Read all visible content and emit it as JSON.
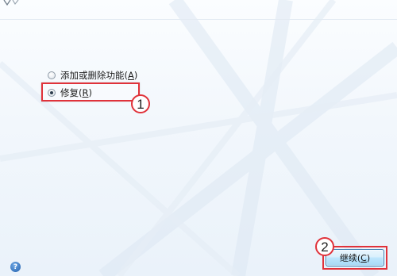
{
  "options": [
    {
      "label": "添加或删除功能",
      "accel": "A",
      "selected": false
    },
    {
      "label": "修复",
      "accel": "R",
      "selected": true
    }
  ],
  "markers": {
    "step1": "1",
    "step2": "2"
  },
  "continue_button": {
    "label": "继续",
    "accel": "C"
  },
  "help": {
    "glyph": "?"
  },
  "colors": {
    "highlight": "#e0323a",
    "button_top": "#eaf6fd",
    "button_bottom": "#a7d9f5"
  }
}
